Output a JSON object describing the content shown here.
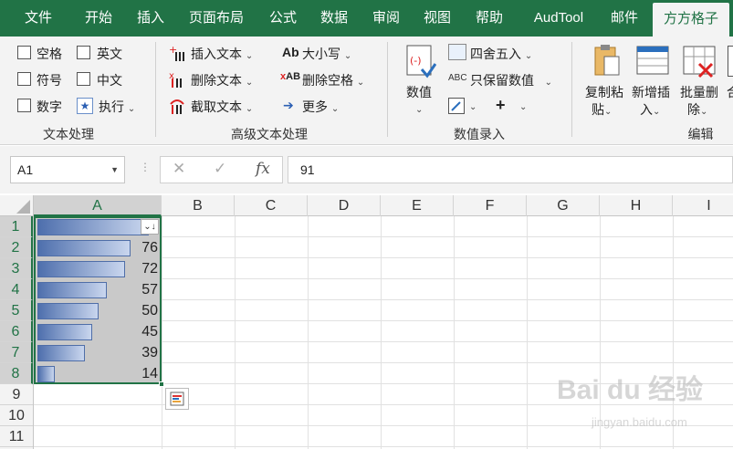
{
  "tabs": [
    "文件",
    "开始",
    "插入",
    "页面布局",
    "公式",
    "数据",
    "审阅",
    "视图",
    "帮助",
    "AudTool",
    "邮件",
    "方方格子"
  ],
  "ribbon": {
    "text_group": {
      "checkboxes": [
        "空格",
        "英文",
        "符号",
        "中文",
        "数字"
      ],
      "execute": "执行",
      "name": "文本处理"
    },
    "adv_group": {
      "insert": "插入文本",
      "delete": "删除文本",
      "extract": "截取文本",
      "case": "大小写",
      "del_space": "删除空格",
      "more": "更多",
      "name": "高级文本处理"
    },
    "num_group": {
      "value_btn": "数值",
      "round": "四舍五入",
      "keep_num": "只保留数值",
      "name": "数值录入"
    },
    "edit_group": {
      "copy_paste": [
        "复制粘",
        "贴"
      ],
      "add_insert": [
        "新增插",
        "入"
      ],
      "batch_del": [
        "批量删",
        "除"
      ],
      "partial": "合",
      "name": "编辑"
    }
  },
  "namebox": "A1",
  "formula_value": "91",
  "columns": [
    "A",
    "B",
    "C",
    "D",
    "E",
    "F",
    "G",
    "H",
    "I"
  ],
  "rows": [
    "1",
    "2",
    "3",
    "4",
    "5",
    "6",
    "7",
    "8",
    "9",
    "10",
    "11"
  ],
  "cells": [
    {
      "row": "1",
      "value": "",
      "fraction": 0.91
    },
    {
      "row": "2",
      "value": "76",
      "fraction": 0.76
    },
    {
      "row": "3",
      "value": "72",
      "fraction": 0.72
    },
    {
      "row": "4",
      "value": "57",
      "fraction": 0.57
    },
    {
      "row": "5",
      "value": "50",
      "fraction": 0.5
    },
    {
      "row": "6",
      "value": "45",
      "fraction": 0.45
    },
    {
      "row": "7",
      "value": "39",
      "fraction": 0.39
    },
    {
      "row": "8",
      "value": "14",
      "fraction": 0.14
    }
  ],
  "accent": "#217346"
}
